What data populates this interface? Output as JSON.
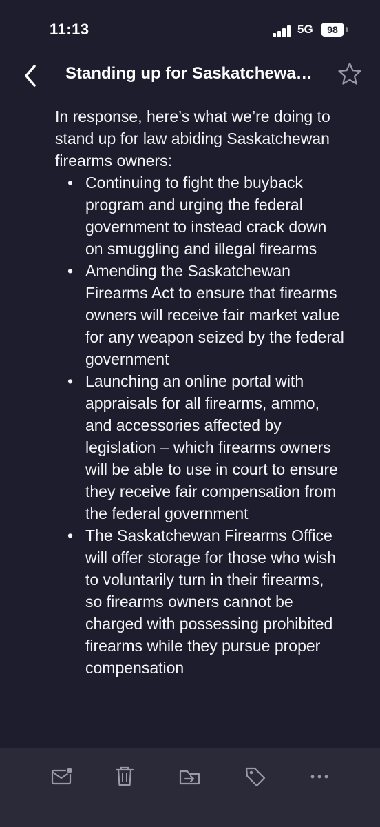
{
  "status_bar": {
    "time": "11:13",
    "network": "5G",
    "battery": "98"
  },
  "nav": {
    "title": "Standing up for Saskatchewan firearms owners",
    "back_icon": "chevron-left-icon",
    "favorite_icon": "star-icon"
  },
  "article": {
    "intro": "In response, here’s what we’re doing to stand up for law abiding Saskatchewan firearms owners:",
    "bullets": [
      "Continuing to fight the buyback program and urging the federal government to instead crack down on smuggling and illegal firearms",
      "Amending the Saskatchewan Firearms Act to ensure that firearms owners will receive fair market value for any weapon seized by the federal government",
      "Launching an online portal with appraisals for all firearms, ammo, and accessories affected by legislation – which firearms owners will be able to use in court to ensure they receive fair compensation from the federal government",
      "The Saskatchewan Firearms Office will offer storage for those who wish to voluntarily turn in their firearms, so firearms owners cannot be charged with possessing prohibited firearms while they pursue proper compensation"
    ]
  },
  "toolbar": {
    "items": [
      "mark-unread-icon",
      "trash-icon",
      "move-to-folder-icon",
      "tag-icon",
      "more-icon"
    ]
  },
  "colors": {
    "background": "#1e1d2d",
    "toolbar": "#2b2a38",
    "text": "#ffffff",
    "icon": "#9a9aa6"
  }
}
